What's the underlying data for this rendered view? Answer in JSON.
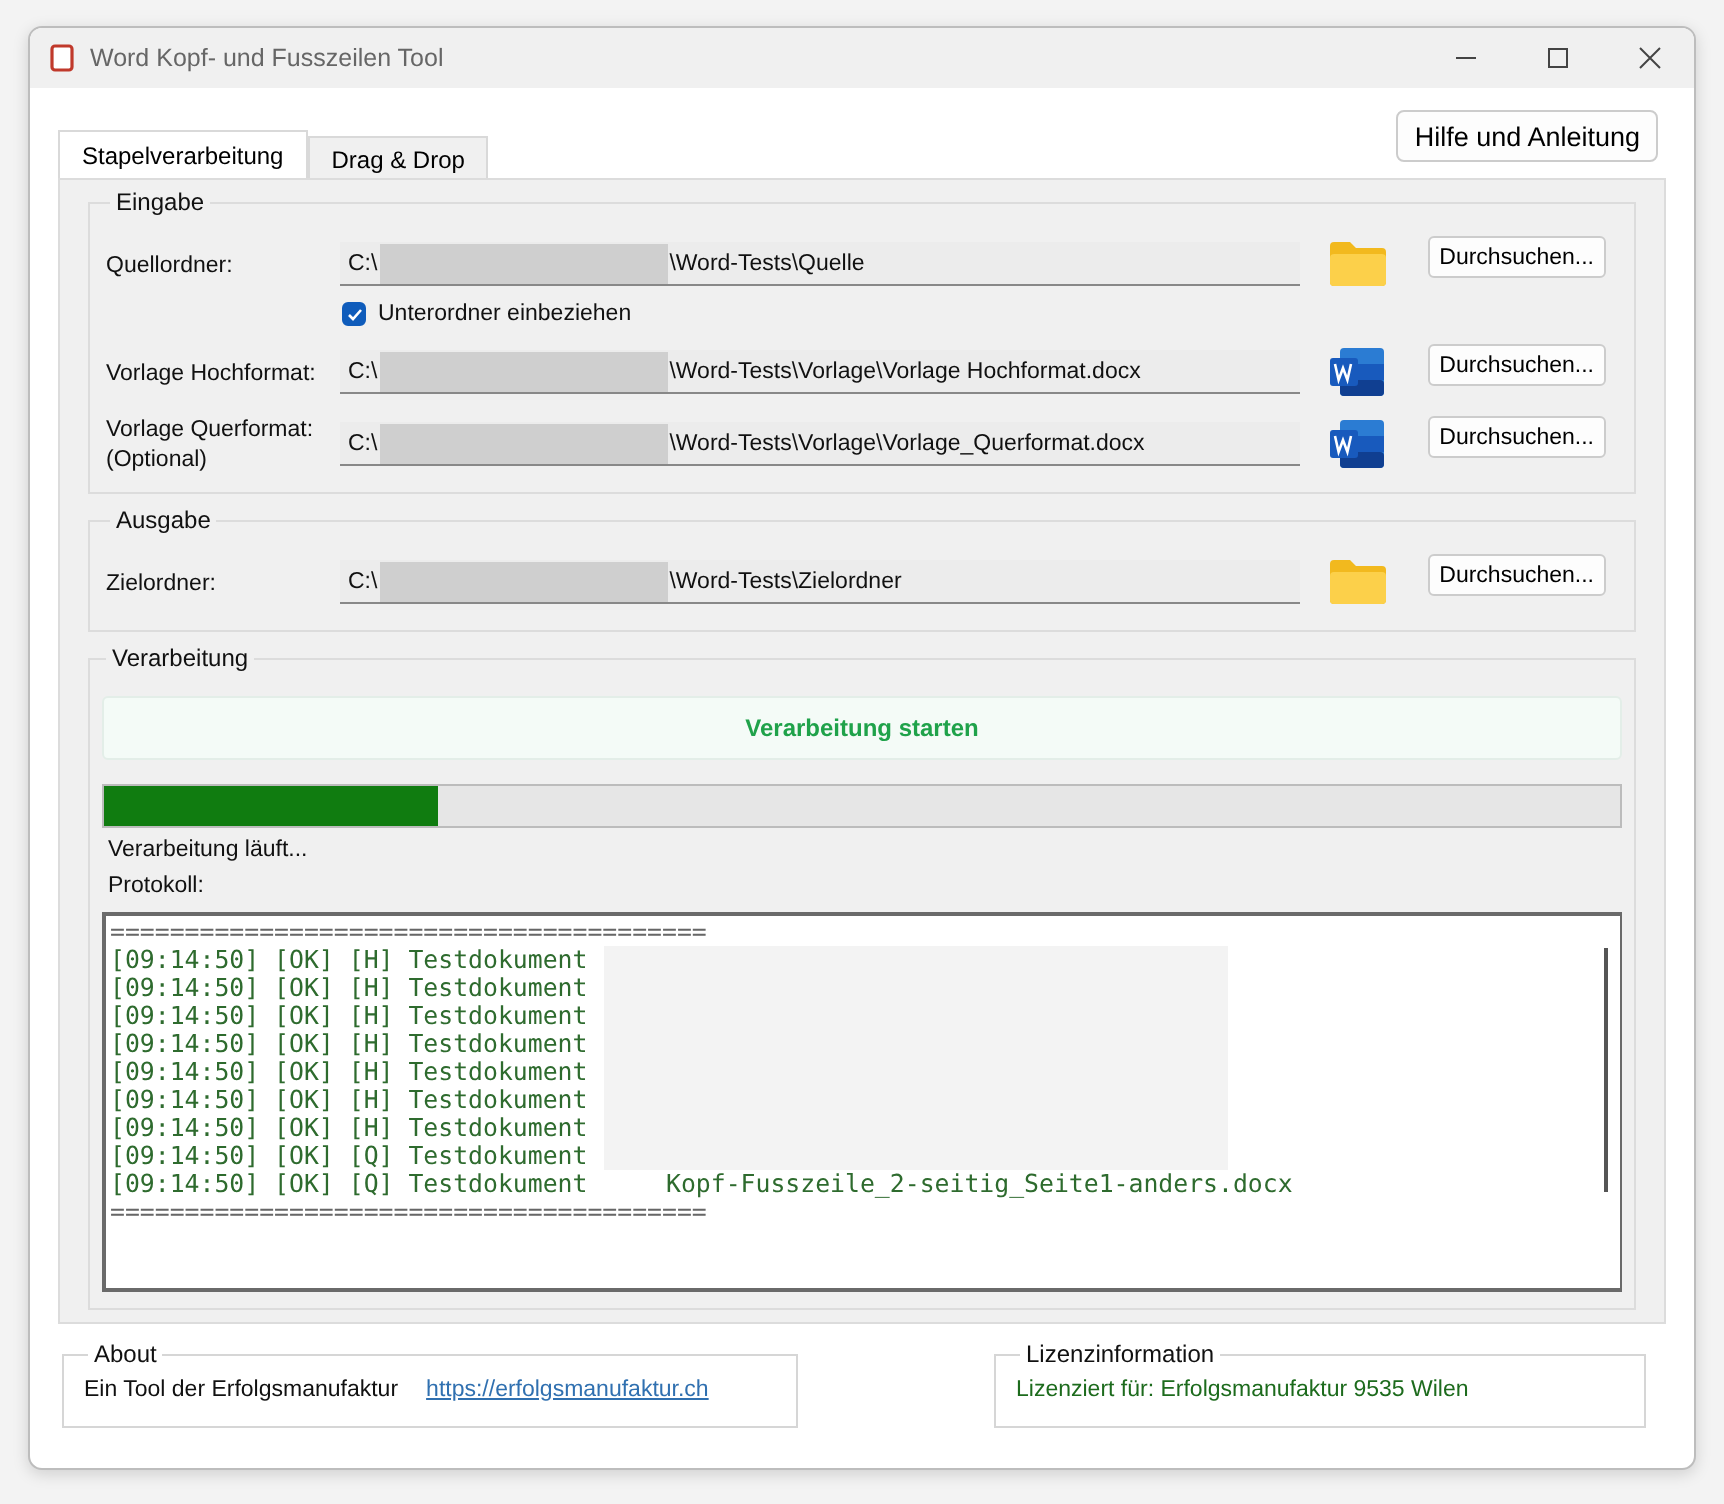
{
  "window": {
    "title": "Word Kopf- und Fusszeilen Tool"
  },
  "tabs": [
    {
      "label": "Stapelverarbeitung",
      "selected": true
    },
    {
      "label": "Drag & Drop",
      "selected": false
    }
  ],
  "help_button": "Hilfe und Anleitung",
  "input_group": {
    "title": "Eingabe",
    "rows": [
      {
        "label": "Quellordner:",
        "prefix": "C:\\",
        "suffix": "\\Word-Tests\\Quelle",
        "kind": "folder",
        "button": "Durchsuchen...",
        "checkbox": {
          "label": "Unterordner einbeziehen",
          "checked": true
        }
      },
      {
        "label": "Vorlage Hochformat:",
        "prefix": "C:\\",
        "suffix": "\\Word-Tests\\Vorlage\\Vorlage Hochformat.docx",
        "kind": "word",
        "button": "Durchsuchen..."
      },
      {
        "label": "Vorlage Querformat:",
        "sublabel": "(Optional)",
        "prefix": "C:\\",
        "suffix": "\\Word-Tests\\Vorlage\\Vorlage_Querformat.docx",
        "kind": "word",
        "button": "Durchsuchen..."
      }
    ]
  },
  "output_group": {
    "title": "Ausgabe",
    "rows": [
      {
        "label": "Zielordner:",
        "prefix": "C:\\",
        "suffix": "\\Word-Tests\\Zielordner",
        "kind": "folder",
        "button": "Durchsuchen..."
      }
    ]
  },
  "processing": {
    "title": "Verarbeitung",
    "start_button": "Verarbeitung starten",
    "progress": {
      "level": 0.22
    },
    "status": "Verarbeitung läuft...",
    "log_label": "Protokoll:",
    "log": [
      "========================================",
      "[09:14:50] [OK] [H] Testdokument",
      "[09:14:50] [OK] [H] Testdokument",
      "[09:14:50] [OK] [H] Testdokument",
      "[09:14:50] [OK] [H] Testdokument",
      "[09:14:50] [OK] [H] Testdokument",
      "[09:14:50] [OK] [H] Testdokument",
      "[09:14:50] [OK] [H] Testdokument",
      "[09:14:50] [OK] [Q] Testdokument",
      "[09:14:50] [OK] [Q] Testdokument",
      "========================================"
    ],
    "log_tail": "Kopf-Fusszeile_2-seitig_Seite1-anders.docx"
  },
  "about": {
    "title": "About",
    "text": "Ein Tool der Erfolgsmanufaktur",
    "link": "https://erfolgsmanufaktur.ch"
  },
  "license": {
    "title": "Lizenzinformation",
    "text": "Lizenziert für: Erfolgsmanufaktur 9535 Wilen"
  }
}
